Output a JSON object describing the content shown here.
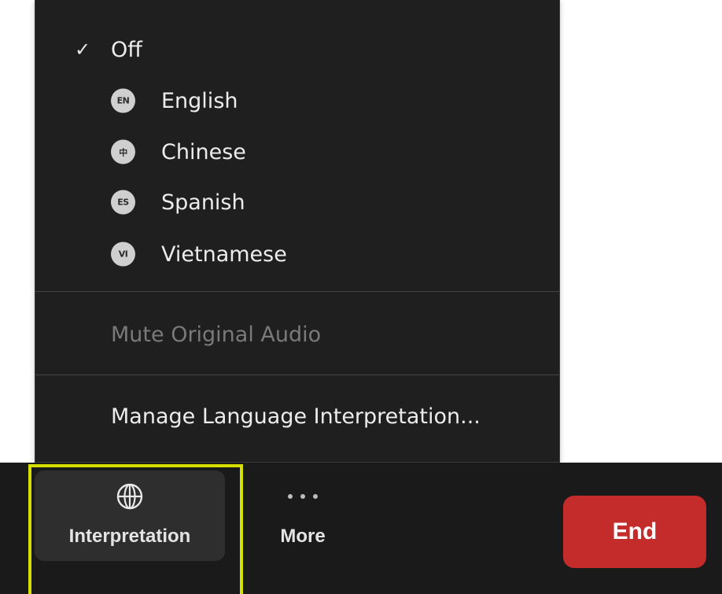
{
  "menu": {
    "off_check": "✓",
    "off_label": "Off",
    "languages": [
      {
        "code": "EN",
        "label": "English"
      },
      {
        "code": "中",
        "label": "Chinese"
      },
      {
        "code": "ES",
        "label": "Spanish"
      },
      {
        "code": "VI",
        "label": "Vietnamese"
      }
    ],
    "mute_label": "Mute Original Audio",
    "manage_label": "Manage Language Interpretation..."
  },
  "toolbar": {
    "interpretation_label": "Interpretation",
    "interpretation_icon": "globe-icon",
    "more_label": "More",
    "more_icon": "more-dots-icon",
    "end_label": "End"
  },
  "colors": {
    "menu_bg": "#1f1f1f",
    "toolbar_bg": "#1a1a1a",
    "end_red": "#c42b2b",
    "highlight": "#d6e000"
  }
}
